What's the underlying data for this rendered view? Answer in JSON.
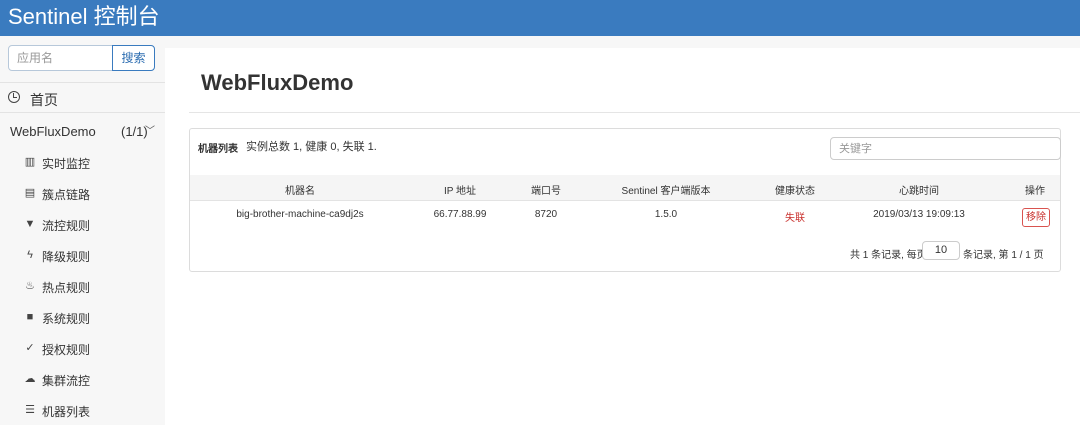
{
  "header": {
    "brand": "Sentinel 控制台"
  },
  "sidebar": {
    "search": {
      "placeholder": "应用名",
      "button_label": "搜索"
    },
    "home_label": "首页",
    "app": {
      "name": "WebFluxDemo",
      "count": "(1/1)"
    },
    "items": [
      {
        "label": "实时监控",
        "icon": "bar-chart-icon",
        "glyph": "▥"
      },
      {
        "label": "簇点链路",
        "icon": "list-icon",
        "glyph": "▤"
      },
      {
        "label": "流控规则",
        "icon": "filter-icon",
        "glyph": "▼"
      },
      {
        "label": "降级规则",
        "icon": "flash-icon",
        "glyph": "ϟ"
      },
      {
        "label": "热点规则",
        "icon": "fire-icon",
        "glyph": "♨"
      },
      {
        "label": "系统规则",
        "icon": "lock-icon",
        "glyph": "■"
      },
      {
        "label": "授权规则",
        "icon": "check-circle-icon",
        "glyph": "✓"
      },
      {
        "label": "集群流控",
        "icon": "cloud-icon",
        "glyph": "☁"
      },
      {
        "label": "机器列表",
        "icon": "th-list-icon",
        "glyph": "☰"
      }
    ]
  },
  "main": {
    "title": "WebFluxDemo",
    "panel": {
      "heading": "机器列表",
      "summary": "实例总数 1, 健康 0, 失联 1.",
      "keyword_placeholder": "关键字",
      "columns": [
        "机器名",
        "IP 地址",
        "端口号",
        "Sentinel 客户端版本",
        "健康状态",
        "心跳时间",
        "操作"
      ],
      "rows": [
        {
          "machine": "big-brother-machine-ca9dj2s",
          "ip": "66.77.88.99",
          "port": "8720",
          "version": "1.5.0",
          "status": "失联",
          "heartbeat": "2019/03/13 19:09:13",
          "action": "移除"
        }
      ],
      "pager": {
        "prefix": "共 1 条记录, 每页",
        "page_size": "10",
        "suffix": "条记录, 第 1 / 1 页"
      }
    }
  },
  "colors": {
    "header_bg": "#3a7bbf",
    "danger": "#c9302c"
  }
}
